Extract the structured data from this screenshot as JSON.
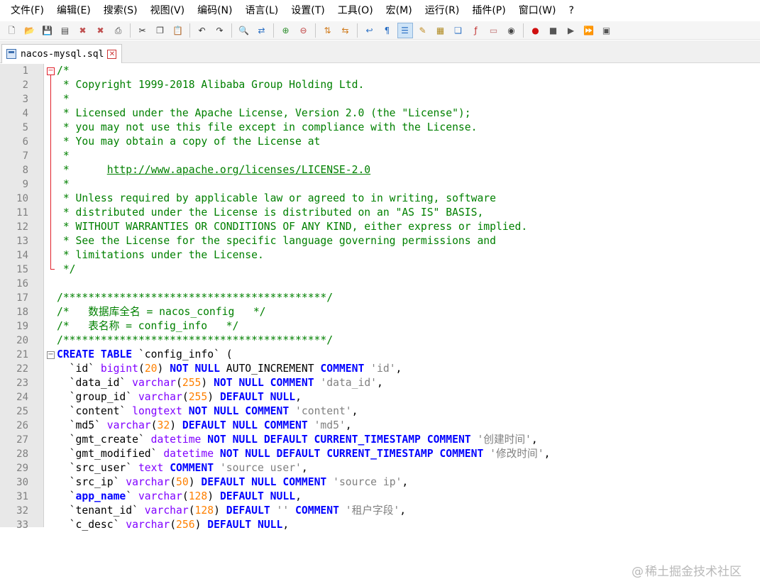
{
  "menu": [
    "文件(F)",
    "编辑(E)",
    "搜索(S)",
    "视图(V)",
    "编码(N)",
    "语言(L)",
    "设置(T)",
    "工具(O)",
    "宏(M)",
    "运行(R)",
    "插件(P)",
    "窗口(W)",
    "?"
  ],
  "toolbar": [
    {
      "name": "new-file-icon",
      "glyph": "🗋",
      "color": "#555555"
    },
    {
      "name": "open-file-icon",
      "glyph": "📂",
      "color": "#d8a13a"
    },
    {
      "name": "save-icon",
      "glyph": "💾",
      "color": "#444444"
    },
    {
      "name": "save-all-icon",
      "glyph": "▤",
      "color": "#444444"
    },
    {
      "name": "close-icon",
      "glyph": "✖",
      "color": "#c05050"
    },
    {
      "name": "close-all-icon",
      "glyph": "✖",
      "color": "#c05050"
    },
    {
      "name": "print-icon",
      "glyph": "⎙",
      "color": "#444444"
    },
    {
      "sep": true
    },
    {
      "name": "cut-icon",
      "glyph": "✂",
      "color": "#333333"
    },
    {
      "name": "copy-icon",
      "glyph": "❐",
      "color": "#444444"
    },
    {
      "name": "paste-icon",
      "glyph": "📋",
      "color": "#8a6a3a"
    },
    {
      "sep": true
    },
    {
      "name": "undo-icon",
      "glyph": "↶",
      "color": "#333333"
    },
    {
      "name": "redo-icon",
      "glyph": "↷",
      "color": "#333333"
    },
    {
      "sep": true
    },
    {
      "name": "find-icon",
      "glyph": "🔍",
      "color": "#333333"
    },
    {
      "name": "replace-icon",
      "glyph": "⇄",
      "color": "#2a6fc4"
    },
    {
      "sep": true
    },
    {
      "name": "zoom-in-icon",
      "glyph": "⊕",
      "color": "#2f8f2f"
    },
    {
      "name": "zoom-out-icon",
      "glyph": "⊖",
      "color": "#c04040"
    },
    {
      "sep": true
    },
    {
      "name": "sync-vertical-icon",
      "glyph": "⇅",
      "color": "#d07a1a"
    },
    {
      "name": "sync-horizontal-icon",
      "glyph": "⇆",
      "color": "#d07a1a"
    },
    {
      "sep": true
    },
    {
      "name": "word-wrap-icon",
      "glyph": "↩",
      "color": "#2a6fc4"
    },
    {
      "name": "show-all-characters-icon",
      "glyph": "¶",
      "color": "#2a6fc4"
    },
    {
      "name": "indent-guide-icon",
      "glyph": "☰",
      "color": "#2a6fc4",
      "active": true
    },
    {
      "name": "define-language-icon",
      "glyph": "✎",
      "color": "#c08a20"
    },
    {
      "name": "document-map-icon",
      "glyph": "▦",
      "color": "#b08a20"
    },
    {
      "name": "function-list-icon",
      "glyph": "❏",
      "color": "#2a6fc4"
    },
    {
      "name": "folder-as-workspace-icon",
      "glyph": "ƒ",
      "color": "#c03030"
    },
    {
      "name": "folder-icon",
      "glyph": "▭",
      "color": "#c07070"
    },
    {
      "name": "monitoring-icon",
      "glyph": "◉",
      "color": "#444444"
    },
    {
      "sep": true
    },
    {
      "name": "record-macro-icon",
      "glyph": "●",
      "color": "#d01010"
    },
    {
      "name": "stop-recording-icon",
      "glyph": "■",
      "color": "#555555"
    },
    {
      "name": "playback-macro-icon",
      "glyph": "▶",
      "color": "#555555"
    },
    {
      "name": "run-macro-multiple-icon",
      "glyph": "⏩",
      "color": "#2a4fc4"
    },
    {
      "name": "save-macro-icon",
      "glyph": "▣",
      "color": "#555555"
    }
  ],
  "tab": {
    "title": "nacos-mysql.sql",
    "close": "✕"
  },
  "lines": [
    {
      "n": "1",
      "tokens": [
        [
          "c",
          "/*"
        ]
      ]
    },
    {
      "n": "2",
      "tokens": [
        [
          "c",
          " * Copyright 1999-2018 Alibaba Group Holding Ltd."
        ]
      ]
    },
    {
      "n": "3",
      "tokens": [
        [
          "c",
          " *"
        ]
      ]
    },
    {
      "n": "4",
      "tokens": [
        [
          "c",
          " * Licensed under the Apache License, Version 2.0 (the \"License\");"
        ]
      ]
    },
    {
      "n": "5",
      "tokens": [
        [
          "c",
          " * you may not use this file except in compliance with the License."
        ]
      ]
    },
    {
      "n": "6",
      "tokens": [
        [
          "c",
          " * You may obtain a copy of the License at"
        ]
      ]
    },
    {
      "n": "7",
      "tokens": [
        [
          "c",
          " *"
        ]
      ]
    },
    {
      "n": "8",
      "tokens": [
        [
          "c",
          " *      "
        ],
        [
          "l",
          "http://www.apache.org/licenses/LICENSE-2.0"
        ]
      ]
    },
    {
      "n": "9",
      "tokens": [
        [
          "c",
          " *"
        ]
      ]
    },
    {
      "n": "10",
      "tokens": [
        [
          "c",
          " * Unless required by applicable law or agreed to in writing, software"
        ]
      ]
    },
    {
      "n": "11",
      "tokens": [
        [
          "c",
          " * distributed under the License is distributed on an \"AS IS\" BASIS,"
        ]
      ]
    },
    {
      "n": "12",
      "tokens": [
        [
          "c",
          " * WITHOUT WARRANTIES OR CONDITIONS OF ANY KIND, either express or implied."
        ]
      ]
    },
    {
      "n": "13",
      "tokens": [
        [
          "c",
          " * See the License for the specific language governing permissions and"
        ]
      ]
    },
    {
      "n": "14",
      "tokens": [
        [
          "c",
          " * limitations under the License."
        ]
      ]
    },
    {
      "n": "15",
      "tokens": [
        [
          "c",
          " */"
        ]
      ]
    },
    {
      "n": "16",
      "tokens": []
    },
    {
      "n": "17",
      "tokens": [
        [
          "c",
          "/******************************************/"
        ]
      ]
    },
    {
      "n": "18",
      "tokens": [
        [
          "c",
          "/*   数据库全名 = nacos_config   */"
        ]
      ]
    },
    {
      "n": "19",
      "tokens": [
        [
          "c",
          "/*   表名称 = config_info   */"
        ]
      ]
    },
    {
      "n": "20",
      "tokens": [
        [
          "c",
          "/******************************************/"
        ]
      ]
    },
    {
      "n": "21",
      "tokens": [
        [
          "k",
          "CREATE TABLE"
        ],
        [
          "p",
          " `config_info` ("
        ]
      ]
    },
    {
      "n": "22",
      "tokens": [
        [
          "p",
          "  `id` "
        ],
        [
          "t",
          "bigint"
        ],
        [
          "p",
          "("
        ],
        [
          "n",
          "20"
        ],
        [
          "p",
          ") "
        ],
        [
          "k",
          "NOT NULL"
        ],
        [
          "p",
          " AUTO_INCREMENT "
        ],
        [
          "k",
          "COMMENT"
        ],
        [
          "p",
          " "
        ],
        [
          "s",
          "'id'"
        ],
        [
          "p",
          ","
        ]
      ]
    },
    {
      "n": "23",
      "tokens": [
        [
          "p",
          "  `data_id` "
        ],
        [
          "t",
          "varchar"
        ],
        [
          "p",
          "("
        ],
        [
          "n",
          "255"
        ],
        [
          "p",
          ") "
        ],
        [
          "k",
          "NOT NULL COMMENT"
        ],
        [
          "p",
          " "
        ],
        [
          "s",
          "'data_id'"
        ],
        [
          "p",
          ","
        ]
      ]
    },
    {
      "n": "24",
      "tokens": [
        [
          "p",
          "  `group_id` "
        ],
        [
          "t",
          "varchar"
        ],
        [
          "p",
          "("
        ],
        [
          "n",
          "255"
        ],
        [
          "p",
          ") "
        ],
        [
          "k",
          "DEFAULT NULL"
        ],
        [
          "p",
          ","
        ]
      ]
    },
    {
      "n": "25",
      "tokens": [
        [
          "p",
          "  `content` "
        ],
        [
          "t",
          "longtext"
        ],
        [
          "p",
          " "
        ],
        [
          "k",
          "NOT NULL COMMENT"
        ],
        [
          "p",
          " "
        ],
        [
          "s",
          "'content'"
        ],
        [
          "p",
          ","
        ]
      ]
    },
    {
      "n": "26",
      "tokens": [
        [
          "p",
          "  `md5` "
        ],
        [
          "t",
          "varchar"
        ],
        [
          "p",
          "("
        ],
        [
          "n",
          "32"
        ],
        [
          "p",
          ") "
        ],
        [
          "k",
          "DEFAULT NULL COMMENT"
        ],
        [
          "p",
          " "
        ],
        [
          "s",
          "'md5'"
        ],
        [
          "p",
          ","
        ]
      ]
    },
    {
      "n": "27",
      "tokens": [
        [
          "p",
          "  `gmt_create` "
        ],
        [
          "t",
          "datetime"
        ],
        [
          "p",
          " "
        ],
        [
          "k",
          "NOT NULL DEFAULT CURRENT_TIMESTAMP COMMENT"
        ],
        [
          "p",
          " "
        ],
        [
          "s",
          "'创建时间'"
        ],
        [
          "p",
          ","
        ]
      ]
    },
    {
      "n": "28",
      "tokens": [
        [
          "p",
          "  `gmt_modified` "
        ],
        [
          "t",
          "datetime"
        ],
        [
          "p",
          " "
        ],
        [
          "k",
          "NOT NULL DEFAULT CURRENT_TIMESTAMP COMMENT"
        ],
        [
          "p",
          " "
        ],
        [
          "s",
          "'修改时间'"
        ],
        [
          "p",
          ","
        ]
      ]
    },
    {
      "n": "29",
      "tokens": [
        [
          "p",
          "  `src_user` "
        ],
        [
          "t",
          "text"
        ],
        [
          "p",
          " "
        ],
        [
          "k",
          "COMMENT"
        ],
        [
          "p",
          " "
        ],
        [
          "s",
          "'source user'"
        ],
        [
          "p",
          ","
        ]
      ]
    },
    {
      "n": "30",
      "tokens": [
        [
          "p",
          "  `src_ip` "
        ],
        [
          "t",
          "varchar"
        ],
        [
          "p",
          "("
        ],
        [
          "n",
          "50"
        ],
        [
          "p",
          ") "
        ],
        [
          "k",
          "DEFAULT NULL COMMENT"
        ],
        [
          "p",
          " "
        ],
        [
          "s",
          "'source ip'"
        ],
        [
          "p",
          ","
        ]
      ]
    },
    {
      "n": "31",
      "tokens": [
        [
          "p",
          "  `"
        ],
        [
          "k",
          "app_name"
        ],
        [
          "p",
          "` "
        ],
        [
          "t",
          "varchar"
        ],
        [
          "p",
          "("
        ],
        [
          "n",
          "128"
        ],
        [
          "p",
          ") "
        ],
        [
          "k",
          "DEFAULT NULL"
        ],
        [
          "p",
          ","
        ]
      ]
    },
    {
      "n": "32",
      "tokens": [
        [
          "p",
          "  `tenant_id` "
        ],
        [
          "t",
          "varchar"
        ],
        [
          "p",
          "("
        ],
        [
          "n",
          "128"
        ],
        [
          "p",
          ") "
        ],
        [
          "k",
          "DEFAULT"
        ],
        [
          "p",
          " "
        ],
        [
          "s",
          "''"
        ],
        [
          "p",
          " "
        ],
        [
          "k",
          "COMMENT"
        ],
        [
          "p",
          " "
        ],
        [
          "s",
          "'租户字段'"
        ],
        [
          "p",
          ","
        ]
      ]
    },
    {
      "n": "33",
      "tokens": [
        [
          "p",
          "  `c_desc` "
        ],
        [
          "t",
          "varchar"
        ],
        [
          "p",
          "("
        ],
        [
          "n",
          "256"
        ],
        [
          "p",
          ") "
        ],
        [
          "k",
          "DEFAULT NULL"
        ],
        [
          "p",
          ","
        ]
      ]
    }
  ],
  "watermark": "稀土掘金技术社区"
}
